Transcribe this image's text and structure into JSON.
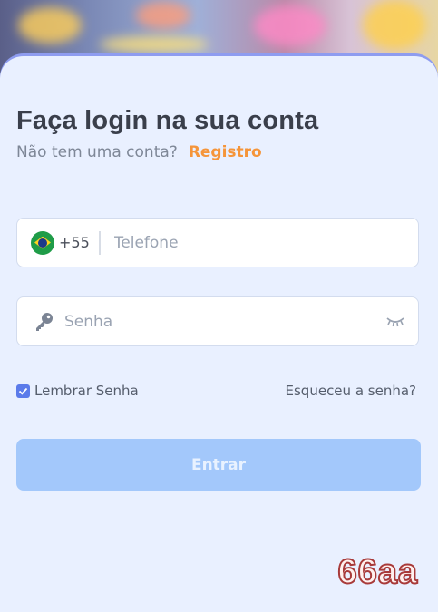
{
  "login": {
    "title": "Faça login na sua conta",
    "subtitle_prefix": "Não tem uma conta?",
    "register_link": "Registro",
    "phone": {
      "country_code": "+55",
      "flag_icon": "brazil-flag-icon",
      "placeholder": "Telefone",
      "value": ""
    },
    "password": {
      "placeholder": "Senha",
      "value": "",
      "key_icon": "key-icon",
      "visibility_icon": "eye-closed-icon"
    },
    "remember_label": "Lembrar Senha",
    "remember_checked": true,
    "forgot_link": "Esqueceu a senha?",
    "submit_label": "Entrar"
  },
  "brand": {
    "watermark": "66aa"
  },
  "colors": {
    "accent_orange": "#f5953a",
    "button_disabled": "#a3c8fb",
    "checkbox_blue": "#5b7bea",
    "page_bg": "#e9f0ff"
  }
}
